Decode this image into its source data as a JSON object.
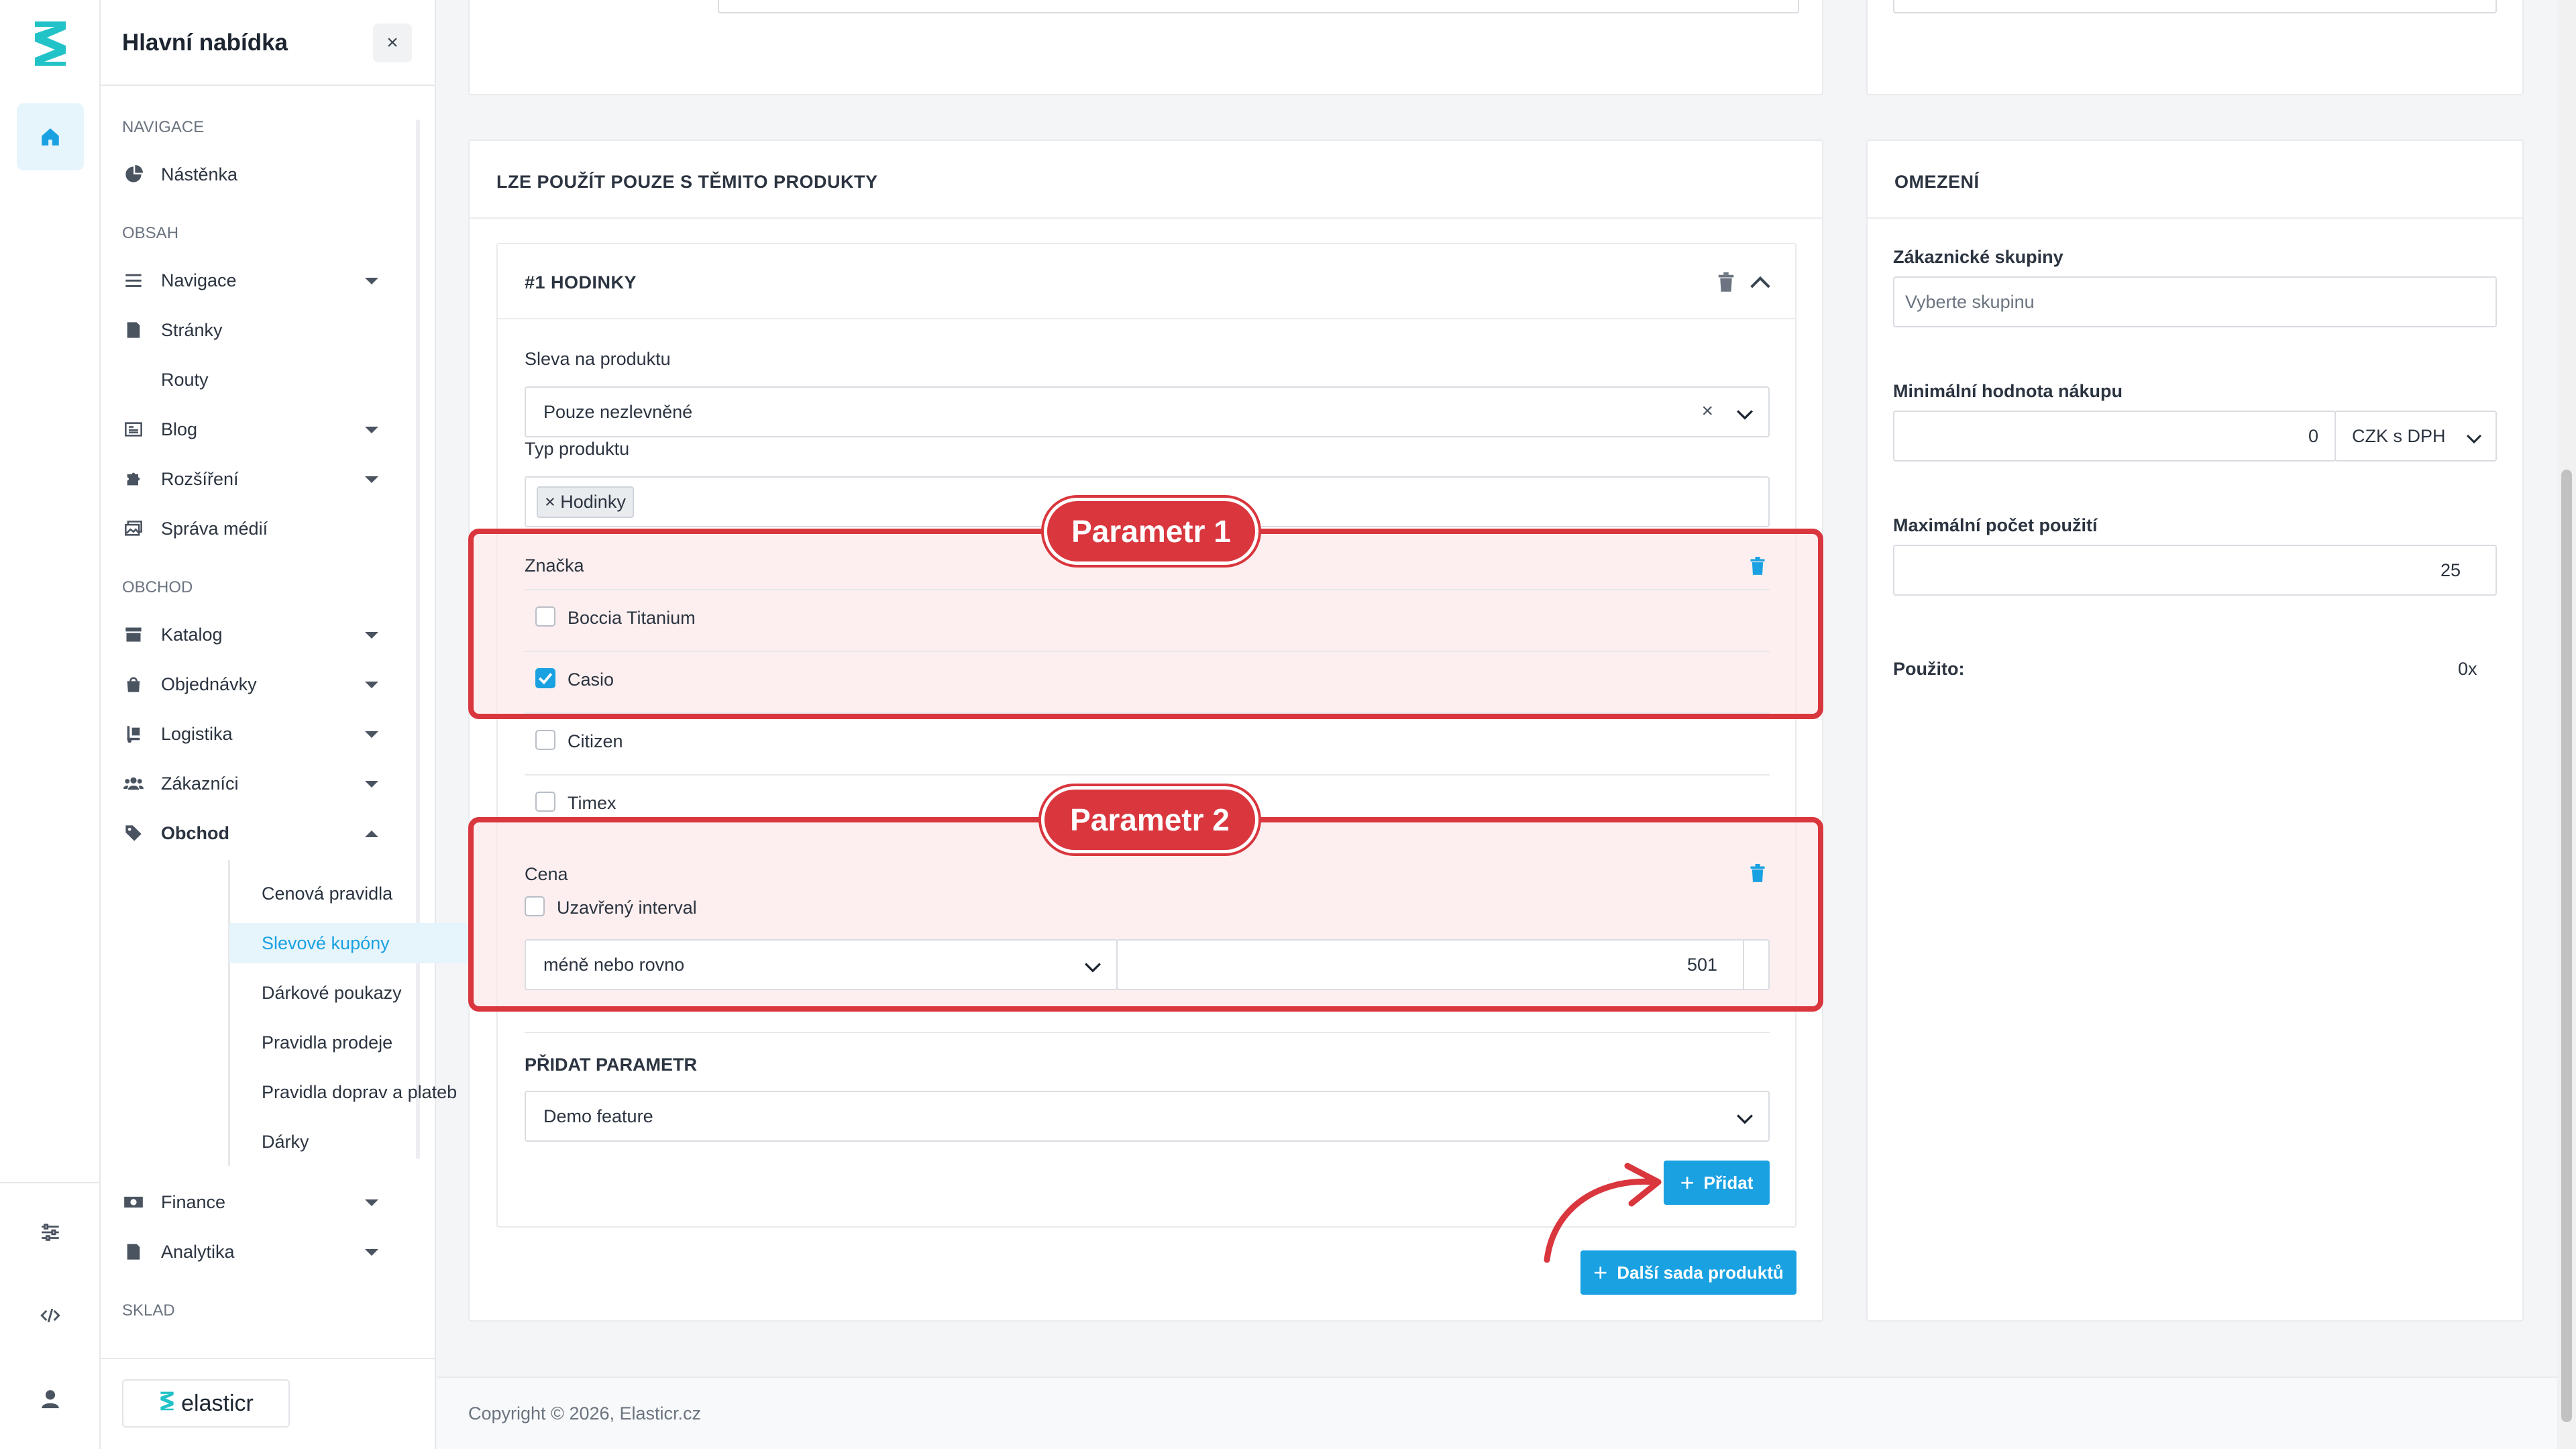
{
  "sidebar": {
    "title": "Hlavní nabídka",
    "close": "×",
    "sections": {
      "navigace": "NAVIGACE",
      "obsah": "OBSAH",
      "obchod": "OBCHOD",
      "sklad": "SKLAD"
    },
    "items": {
      "nastenka": "Nástěnka",
      "navigace": "Navigace",
      "stranky": "Stránky",
      "routy": "Routy",
      "blog": "Blog",
      "rozsireni": "Rozšíření",
      "sprava_medii": "Správa médií",
      "katalog": "Katalog",
      "objednavky": "Objednávky",
      "logistika": "Logistika",
      "zakaznici": "Zákazníci",
      "obchod": "Obchod",
      "finance": "Finance",
      "analytika": "Analytika"
    },
    "obchod_sub": {
      "cenova_pravidla": "Cenová pravidla",
      "slevove_kupony": "Slevové kupóny",
      "darkove_poukazy": "Dárkové poukazy",
      "pravidla_prodeje": "Pravidla prodeje",
      "pravidla_doprav": "Pravidla doprav a plateb",
      "darky": "Dárky"
    },
    "brand": "elasticr"
  },
  "products_card": {
    "title": "LZE POUŽÍT POUZE S TĚMITO PRODUKTY",
    "set_title": "#1 HODINKY",
    "discount_label": "Sleva na produktu",
    "discount_value": "Pouze nezlevněné",
    "clear": "×",
    "type_label": "Typ produktu",
    "type_tag": "× Hodinky",
    "brand_label": "Značka",
    "brands": [
      {
        "name": "Boccia Titanium",
        "checked": false
      },
      {
        "name": "Casio",
        "checked": true
      },
      {
        "name": "Citizen",
        "checked": false
      },
      {
        "name": "Timex",
        "checked": false
      }
    ],
    "price_label": "Cena",
    "closed_interval": "Uzavřený interval",
    "operator": "méně nebo rovno",
    "price_value": "501",
    "add_param_label": "PŘIDAT PARAMETR",
    "add_param_value": "Demo feature",
    "add_button": "Přidat",
    "next_set_button": "Další sada produktů"
  },
  "annotations": {
    "param1": "Parametr 1",
    "param2": "Parametr 2",
    "color": "#d9363e"
  },
  "limits_card": {
    "title": "OMEZENÍ",
    "groups_label": "Zákaznické skupiny",
    "groups_placeholder": "Vyberte skupinu",
    "min_label": "Minimální hodnota nákupu",
    "min_value": "0",
    "currency": "CZK s DPH",
    "max_label": "Maximální počet použití",
    "max_value": "25",
    "used_label": "Použito:",
    "used_value": "0x"
  },
  "footer": {
    "copyright": "Copyright © 2026, Elasticr.cz"
  },
  "colors": {
    "accent": "#1aa1e2",
    "accent_bg": "#e6f4fb",
    "brand": "#22c3c8"
  }
}
